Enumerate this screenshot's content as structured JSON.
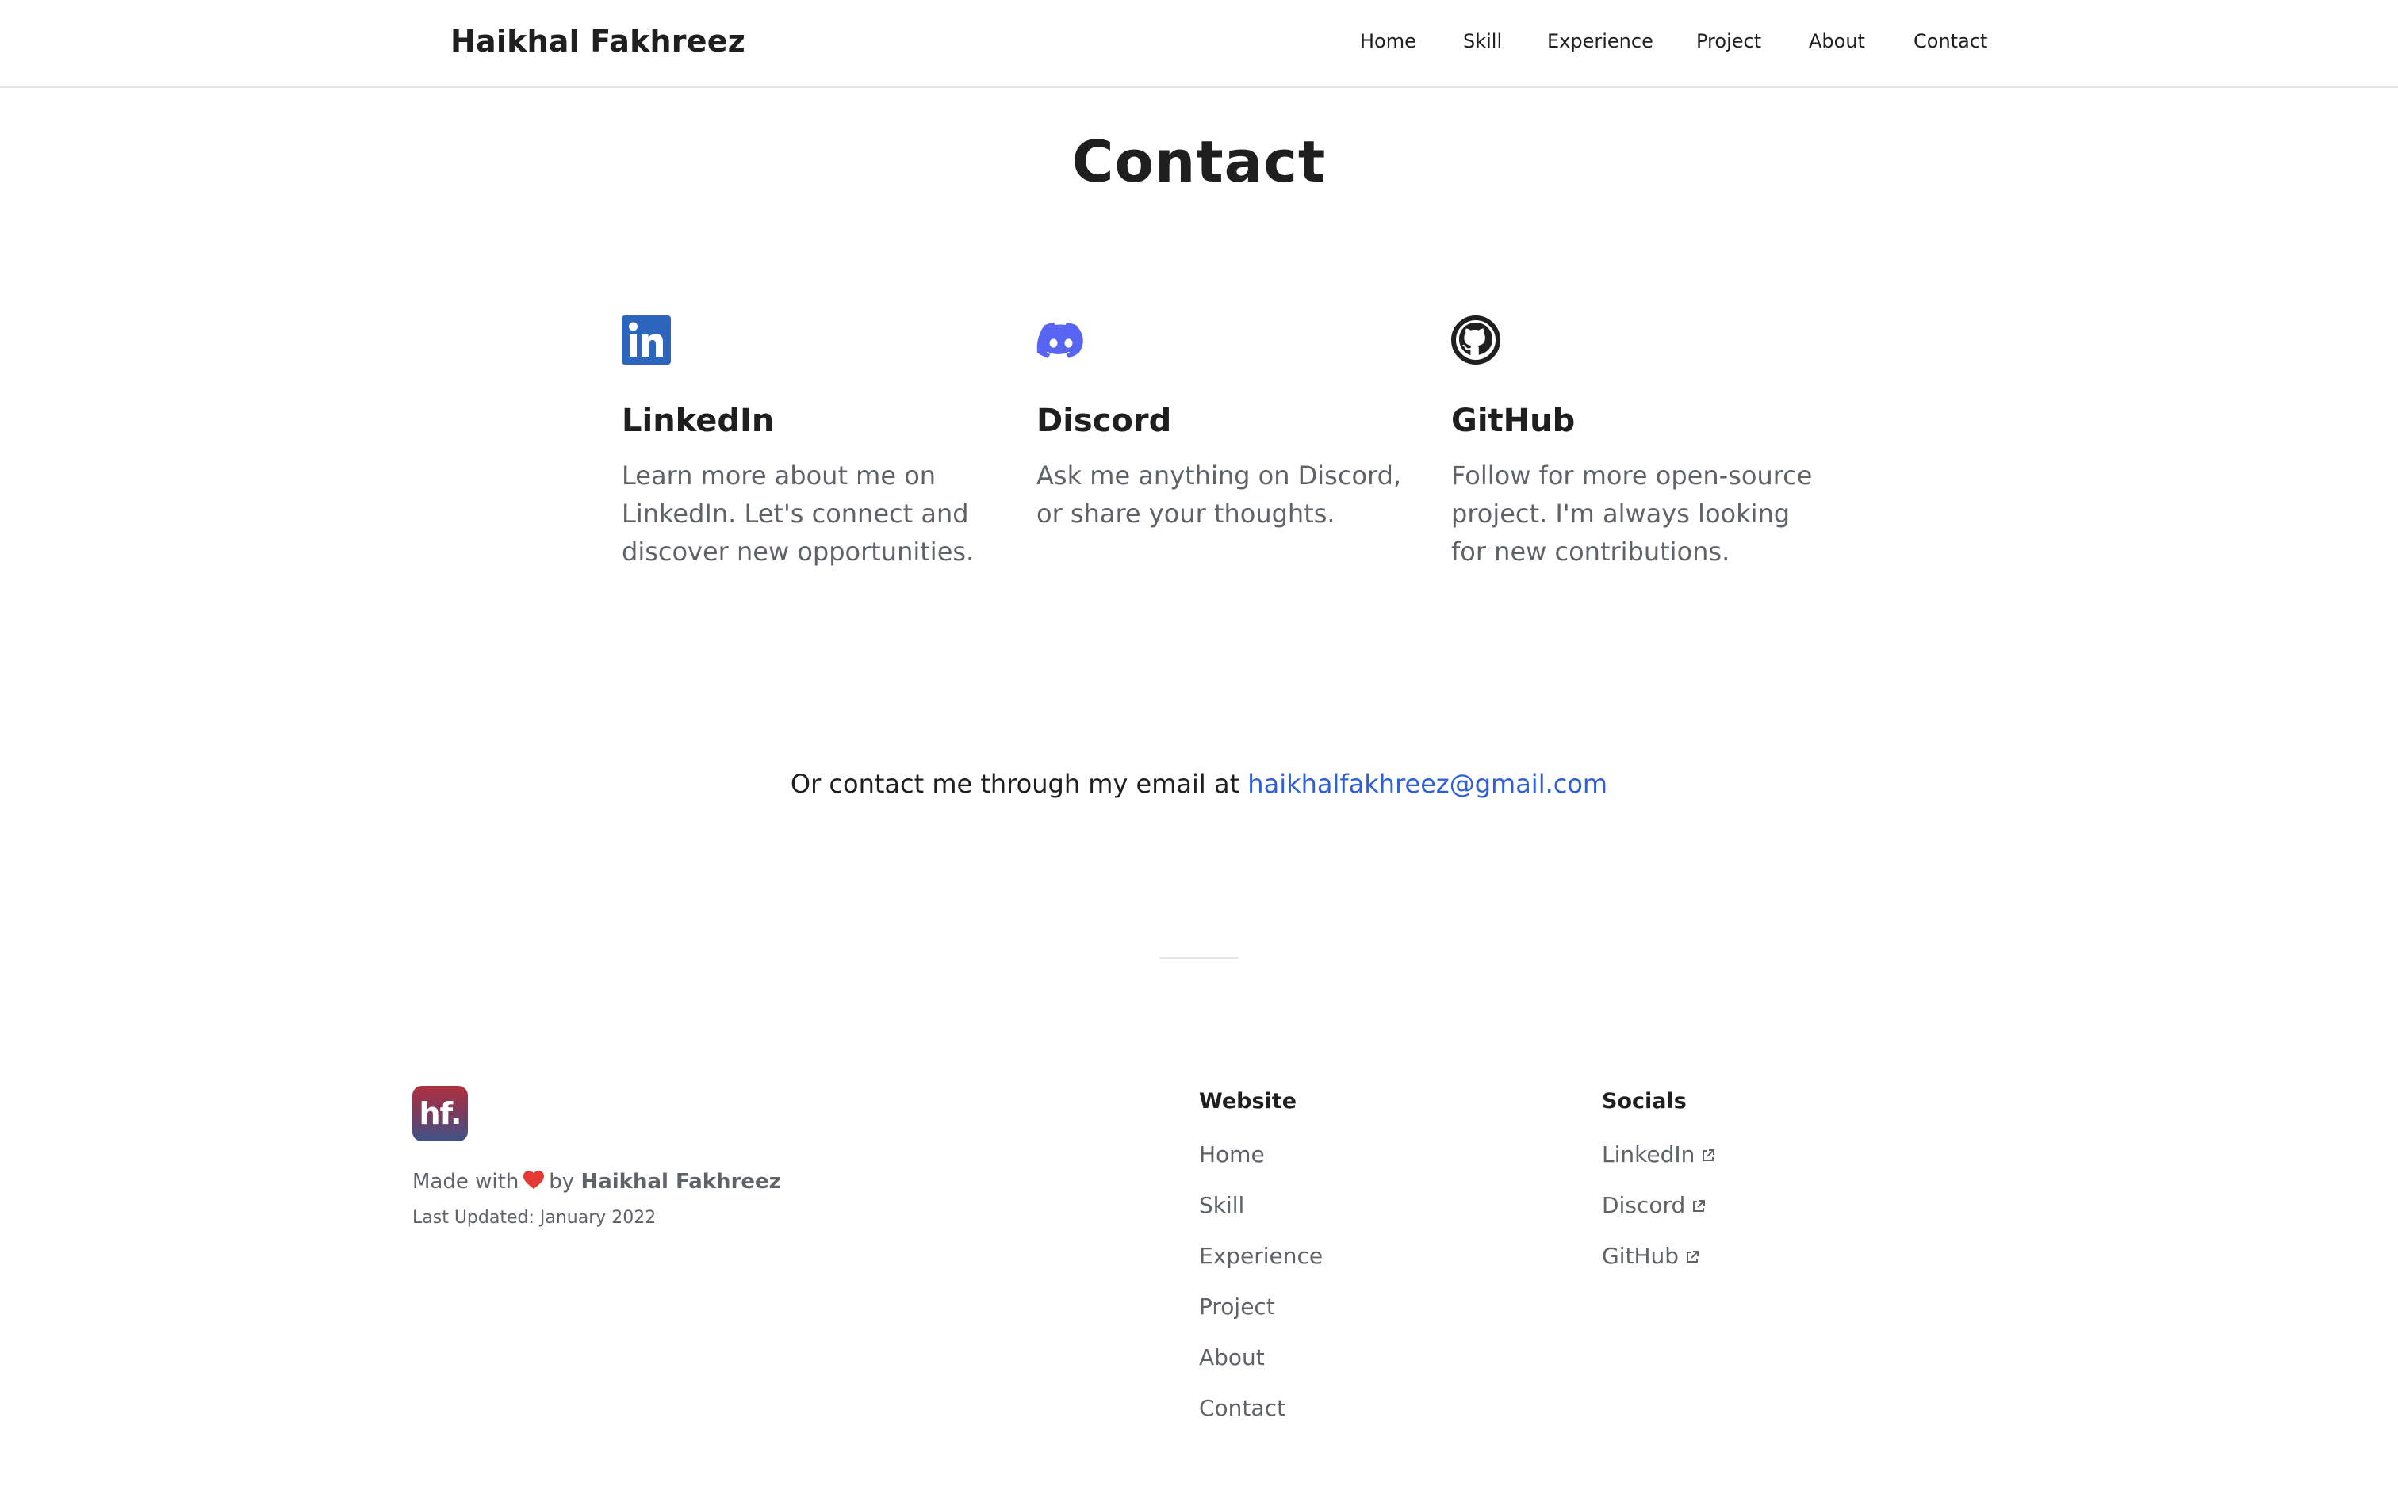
{
  "header": {
    "brand": "Haikhal Fakhreez",
    "nav": [
      "Home",
      "Skill",
      "Experience",
      "Project",
      "About",
      "Contact"
    ]
  },
  "main": {
    "title": "Contact",
    "cards": [
      {
        "icon": "linkedin-icon",
        "title": "LinkedIn",
        "desc": "Learn more about me on LinkedIn. Let's connect and discover new opportunities."
      },
      {
        "icon": "discord-icon",
        "title": "Discord",
        "desc": "Ask me anything on Discord, or share your thoughts."
      },
      {
        "icon": "github-icon",
        "title": "GitHub",
        "desc": "Follow for more open-source project. I'm always looking for new contributions."
      }
    ],
    "email_prefix": "Or contact me through my email at ",
    "email": "haikhalfakhreez@gmail.com"
  },
  "footer": {
    "logo_text": "hf.",
    "made_with": "Made with",
    "by": "by",
    "author": "Haikhal Fakhreez",
    "last_updated": "Last Updated: January 2022",
    "website_heading": "Website",
    "website_links": [
      "Home",
      "Skill",
      "Experience",
      "Project",
      "About",
      "Contact"
    ],
    "socials_heading": "Socials",
    "social_links": [
      "LinkedIn",
      "Discord",
      "GitHub"
    ]
  },
  "colors": {
    "linkedin": "#2d64bc",
    "discord": "#5865f2",
    "link": "#2f5fd8",
    "heart": "#e53935"
  }
}
